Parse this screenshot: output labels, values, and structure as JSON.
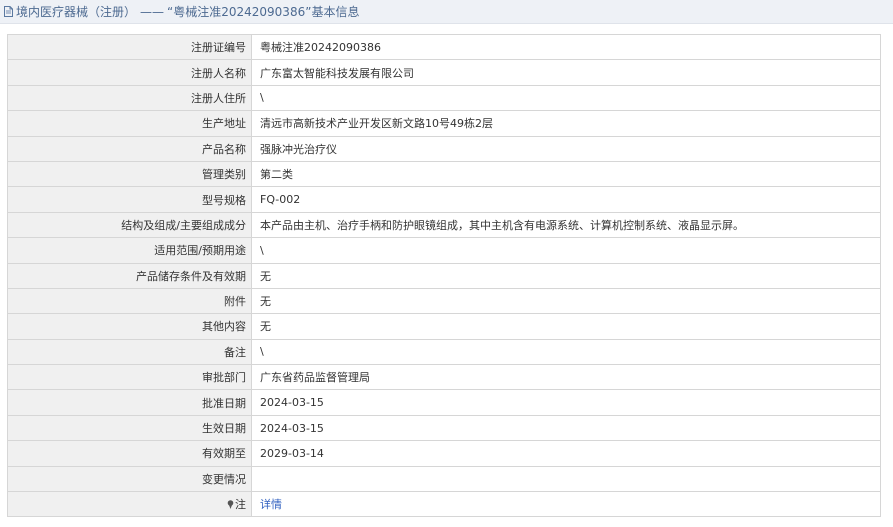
{
  "header": {
    "title_prefix": "境内医疗器械（注册）",
    "separator": "——",
    "title_record": "“粤械注准20242090386”",
    "title_suffix": "基本信息"
  },
  "rows": [
    {
      "label": "注册证编号",
      "value": "粤械注准20242090386"
    },
    {
      "label": "注册人名称",
      "value": "广东富太智能科技发展有限公司"
    },
    {
      "label": "注册人住所",
      "value": "\\"
    },
    {
      "label": "生产地址",
      "value": "清远市高新技术产业开发区新文路10号49栋2层"
    },
    {
      "label": "产品名称",
      "value": "强脉冲光治疗仪"
    },
    {
      "label": "管理类别",
      "value": "第二类"
    },
    {
      "label": "型号规格",
      "value": "FQ-002"
    },
    {
      "label": "结构及组成/主要组成成分",
      "value": "本产品由主机、治疗手柄和防护眼镜组成，其中主机含有电源系统、计算机控制系统、液晶显示屏。"
    },
    {
      "label": "适用范围/预期用途",
      "value": "\\"
    },
    {
      "label": "产品储存条件及有效期",
      "value": "无"
    },
    {
      "label": "附件",
      "value": "无"
    },
    {
      "label": "其他内容",
      "value": "无"
    },
    {
      "label": "备注",
      "value": "\\"
    },
    {
      "label": "审批部门",
      "value": "广东省药品监督管理局"
    },
    {
      "label": "批准日期",
      "value": "2024-03-15"
    },
    {
      "label": "生效日期",
      "value": "2024-03-15"
    },
    {
      "label": "有效期至",
      "value": "2029-03-14"
    },
    {
      "label": "变更情况",
      "value": ""
    }
  ],
  "note": {
    "label": "注",
    "link": "详情"
  },
  "icons": {
    "title": "document-icon",
    "note": "pin-icon"
  },
  "colors": {
    "title_text": "#4d6a91",
    "label_bg": "#f0f0f0",
    "link": "#3060c0"
  }
}
